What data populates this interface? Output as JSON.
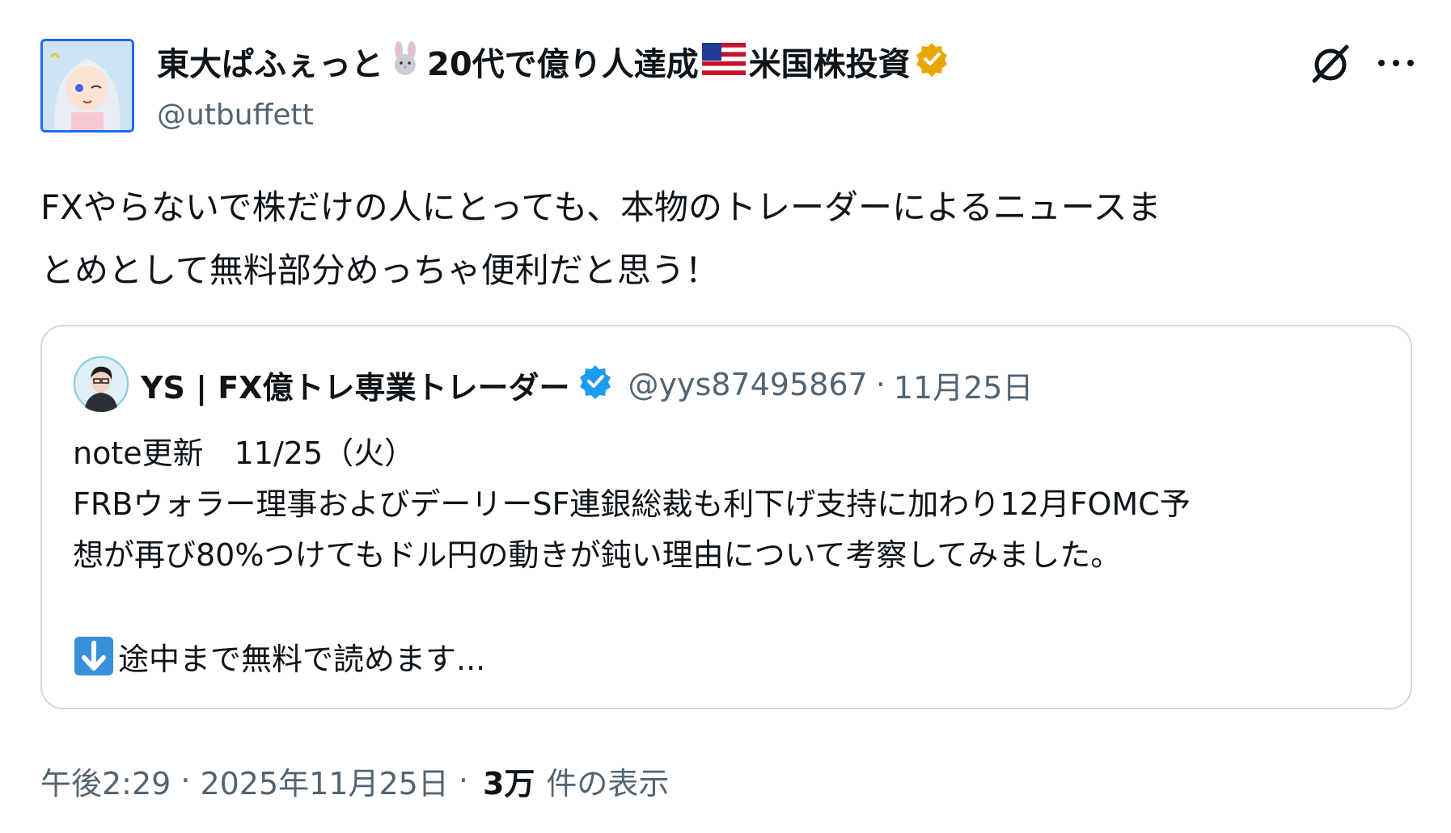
{
  "author": {
    "name_part1": "東大ぱふぇっと",
    "name_part2": "20代で億り人達成",
    "name_part3": "米国株投資",
    "handle": "@utbuffett",
    "verified_badge": "gold"
  },
  "tweet": {
    "text": "FXやらないで株だけの人にとっても、本物のトレーダーによるニュースま\nとめとして無料部分めっちゃ便利だと思う！"
  },
  "quote": {
    "author_name": "YS | FX億トレ専業トレーダー",
    "handle": "@yys87495867",
    "dot": "·",
    "date": "11月25日",
    "text": "note更新　11/25（火）\nFRBウォラー理事およびデーリーSF連銀総裁も利下げ支持に加わり12月FOMC予\n想が再び80%つけてもドル円の動きが鈍い理由について考察してみました。",
    "cta": "途中まで無料で読めます..."
  },
  "footer": {
    "time": "午後2:29",
    "sep1": "·",
    "date": "2025年11月25日",
    "sep2": "·",
    "views": "3万",
    "views_label": "件の表示"
  },
  "colors": {
    "text": "#0f1419",
    "secondary": "#536471",
    "border": "#cfd9de",
    "verified_blue": "#1d9bf0",
    "verified_gold": "#e8a700"
  }
}
